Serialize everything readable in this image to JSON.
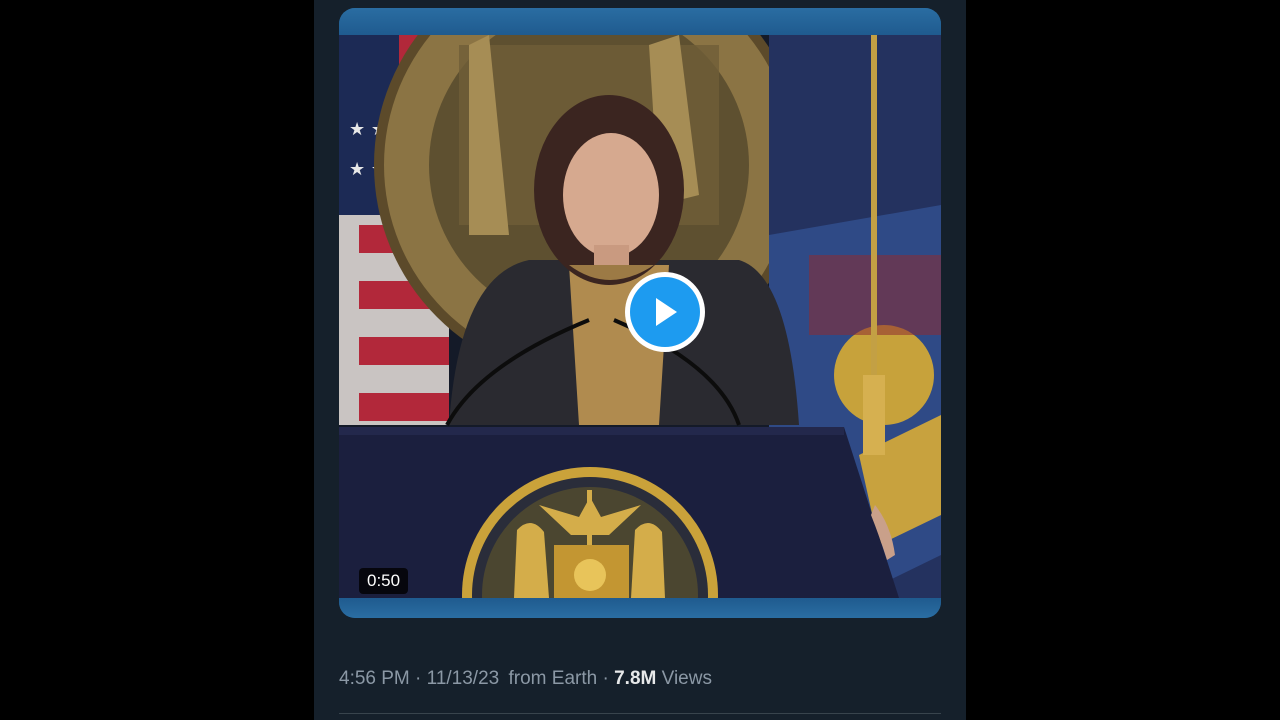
{
  "post": {
    "video": {
      "duration": "0:50",
      "play_icon": "play-icon"
    },
    "meta": {
      "time": "4:56 PM",
      "sep1": "·",
      "date": "11/13/23",
      "source": "from Earth",
      "sep2": "·",
      "views_count": "7.8M",
      "views_label": "Views"
    }
  },
  "colors": {
    "background": "#15202b",
    "accent": "#1d9bf0",
    "muted_text": "#8b98a5",
    "primary_text": "#e7e9ea"
  }
}
